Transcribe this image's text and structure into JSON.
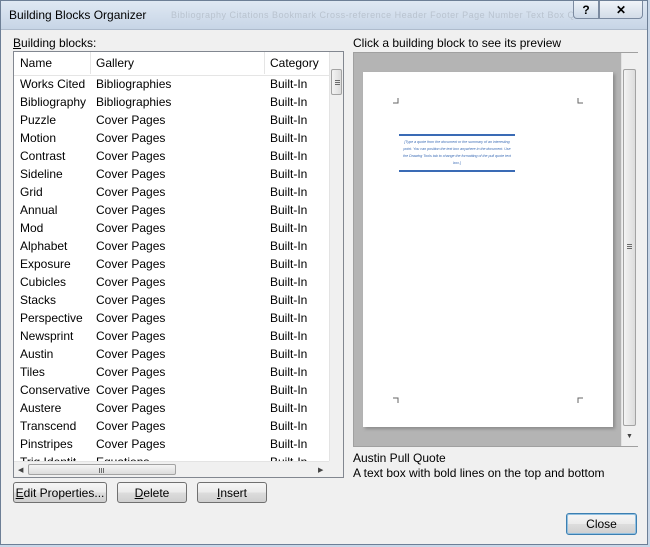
{
  "window": {
    "title": "Building Blocks Organizer",
    "help_label": "?",
    "close_glyph": "✕"
  },
  "background_ribbon_text": "Bibliography  Citations  Bookmark  Cross-reference  Header  Footer  Page Number  Text Box  Quick Parts",
  "left_panel": {
    "label_prefix": "",
    "label_underlined": "B",
    "label_rest": "uilding blocks:",
    "columns": [
      "Name",
      "Gallery",
      "Category"
    ],
    "rows": [
      {
        "name": "Works Cited",
        "gallery": "Bibliographies",
        "category": "Built-In"
      },
      {
        "name": "Bibliography",
        "gallery": "Bibliographies",
        "category": "Built-In"
      },
      {
        "name": "Puzzle",
        "gallery": "Cover Pages",
        "category": "Built-In"
      },
      {
        "name": "Motion",
        "gallery": "Cover Pages",
        "category": "Built-In"
      },
      {
        "name": "Contrast",
        "gallery": "Cover Pages",
        "category": "Built-In"
      },
      {
        "name": "Sideline",
        "gallery": "Cover Pages",
        "category": "Built-In"
      },
      {
        "name": "Grid",
        "gallery": "Cover Pages",
        "category": "Built-In"
      },
      {
        "name": "Annual",
        "gallery": "Cover Pages",
        "category": "Built-In"
      },
      {
        "name": "Mod",
        "gallery": "Cover Pages",
        "category": "Built-In"
      },
      {
        "name": "Alphabet",
        "gallery": "Cover Pages",
        "category": "Built-In"
      },
      {
        "name": "Exposure",
        "gallery": "Cover Pages",
        "category": "Built-In"
      },
      {
        "name": "Cubicles",
        "gallery": "Cover Pages",
        "category": "Built-In"
      },
      {
        "name": "Stacks",
        "gallery": "Cover Pages",
        "category": "Built-In"
      },
      {
        "name": "Perspective",
        "gallery": "Cover Pages",
        "category": "Built-In"
      },
      {
        "name": "Newsprint",
        "gallery": "Cover Pages",
        "category": "Built-In"
      },
      {
        "name": "Austin",
        "gallery": "Cover Pages",
        "category": "Built-In"
      },
      {
        "name": "Tiles",
        "gallery": "Cover Pages",
        "category": "Built-In"
      },
      {
        "name": "Conservative",
        "gallery": "Cover Pages",
        "category": "Built-In"
      },
      {
        "name": "Austere",
        "gallery": "Cover Pages",
        "category": "Built-In"
      },
      {
        "name": "Transcend",
        "gallery": "Cover Pages",
        "category": "Built-In"
      },
      {
        "name": "Pinstripes",
        "gallery": "Cover Pages",
        "category": "Built-In"
      },
      {
        "name": "Trig Identit...",
        "gallery": "Equations",
        "category": "Built-In"
      }
    ],
    "buttons": {
      "edit_underlined": "E",
      "edit_rest": "dit Properties...",
      "delete_underlined": "D",
      "delete_rest": "elete",
      "insert_underlined": "I",
      "insert_rest": "nsert"
    }
  },
  "preview": {
    "label": "Click a building block to see its preview",
    "quote_text": "[Type a quote from the document or the summary of an interesting point. You can position the text box anywhere in the document. Use the Drawing Tools tab to change the formatting of the pull quote text box.]",
    "selected_name": "Austin Pull Quote",
    "selected_description": "A text box with bold lines on the top and bottom"
  },
  "footer": {
    "close_label": "Close"
  },
  "colors": {
    "quote_accent": "#3a6bb5",
    "default_button_border": "#3c7fb1"
  }
}
